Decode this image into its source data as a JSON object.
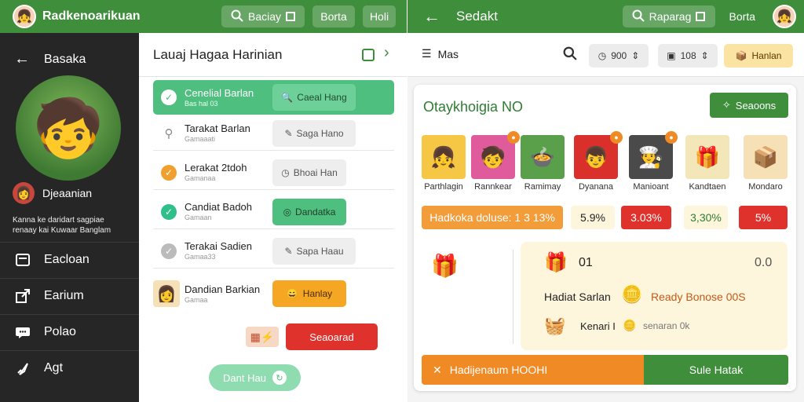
{
  "app_left": {
    "title": "Radkenoarikuan",
    "search_label": "Baciay",
    "btn_a": "Borta",
    "btn_b": "Holi"
  },
  "app_right": {
    "title": "Sedakt",
    "search_label": "Raparag",
    "btn_a": "Borta"
  },
  "sidebar": {
    "back_label": "Basaka",
    "user_name": "Djeaanian",
    "description": "Kanna ke daridart sagpiae renaay kai Kuwaar Banglam",
    "items": [
      {
        "label": "Eacloan",
        "icon": "document-icon"
      },
      {
        "label": "Earium",
        "icon": "export-icon"
      },
      {
        "label": "Polao",
        "icon": "chat-icon"
      },
      {
        "label": "Agt",
        "icon": "rocket-icon"
      }
    ]
  },
  "tasks": {
    "title": "Lauaj Hagaa Harinian",
    "rows": [
      {
        "title": "Cenelial Barlan",
        "sub": "Bas hal 03",
        "button": "Caeal Hang",
        "state": "active"
      },
      {
        "title": "Tarakat Barlan",
        "sub": "Gamaaati",
        "button": "Saga Hano",
        "state": "search"
      },
      {
        "title": "Lerakat 2tdoh",
        "sub": "Gamanaa",
        "button": "Bhoai Han",
        "state": "done-orange"
      },
      {
        "title": "Candiat Badoh",
        "sub": "Gamaan",
        "button": "Dandatka",
        "state": "done-green"
      },
      {
        "title": "Terakai Sadien",
        "sub": "Gamaa33",
        "button": "Sapa Haau",
        "state": "done-gray"
      }
    ],
    "featured": {
      "title": "Dandian Barkian",
      "sub": "Gamaa",
      "button": "Hanlay"
    },
    "red_button": "Seaoarad",
    "green_button": "Dant Hau"
  },
  "right": {
    "toolbar": {
      "menu_label": "Mas",
      "select_a": "900",
      "select_b": "108",
      "hanlan_button": "Hanlan"
    },
    "card": {
      "title": "Otaykhoigia NO",
      "seasons_button": "Seaoons",
      "tiles": [
        {
          "label": "Parthlagin",
          "emoji": "👧",
          "bg": "#f6c744"
        },
        {
          "label": "Rannkear",
          "emoji": "🧒",
          "bg": "#e05b9c"
        },
        {
          "label": "Ramimay",
          "emoji": "🍲",
          "bg": "#5aa04a"
        },
        {
          "label": "Dyanana",
          "emoji": "👦",
          "bg": "#d9302c"
        },
        {
          "label": "Manioant",
          "emoji": "🧑‍🍳",
          "bg": "#4a4a4a"
        },
        {
          "label": "Kandtaen",
          "emoji": "🎁",
          "bg": "#f3e6b8"
        },
        {
          "label": "Mondaro",
          "emoji": "📦",
          "bg": "#f6e0b5"
        }
      ],
      "stats": [
        {
          "label": "Hadkoka doluse: 1 3 13%",
          "style": "orange"
        },
        {
          "label": "5.9%",
          "style": "cream"
        },
        {
          "label": "3.03%",
          "style": "red"
        },
        {
          "label": "3,30%",
          "style": "cream"
        },
        {
          "label": "5%",
          "style": "red"
        }
      ],
      "reward": {
        "top_value_left": "01",
        "top_value_right": "0.0",
        "line1_left": "Hadiat Sarlan",
        "line1_right": "Ready Bonose 00S",
        "line2_left": "Kenari I",
        "line2_right": "senaran 0k"
      },
      "bottom_left": "Hadijenaum HOOHI",
      "bottom_right": "Sule Hatak"
    }
  },
  "colors": {
    "green": "#3e8e3b",
    "accent_green": "#4fbf7f",
    "orange": "#f08a24",
    "red": "#e0322c"
  }
}
